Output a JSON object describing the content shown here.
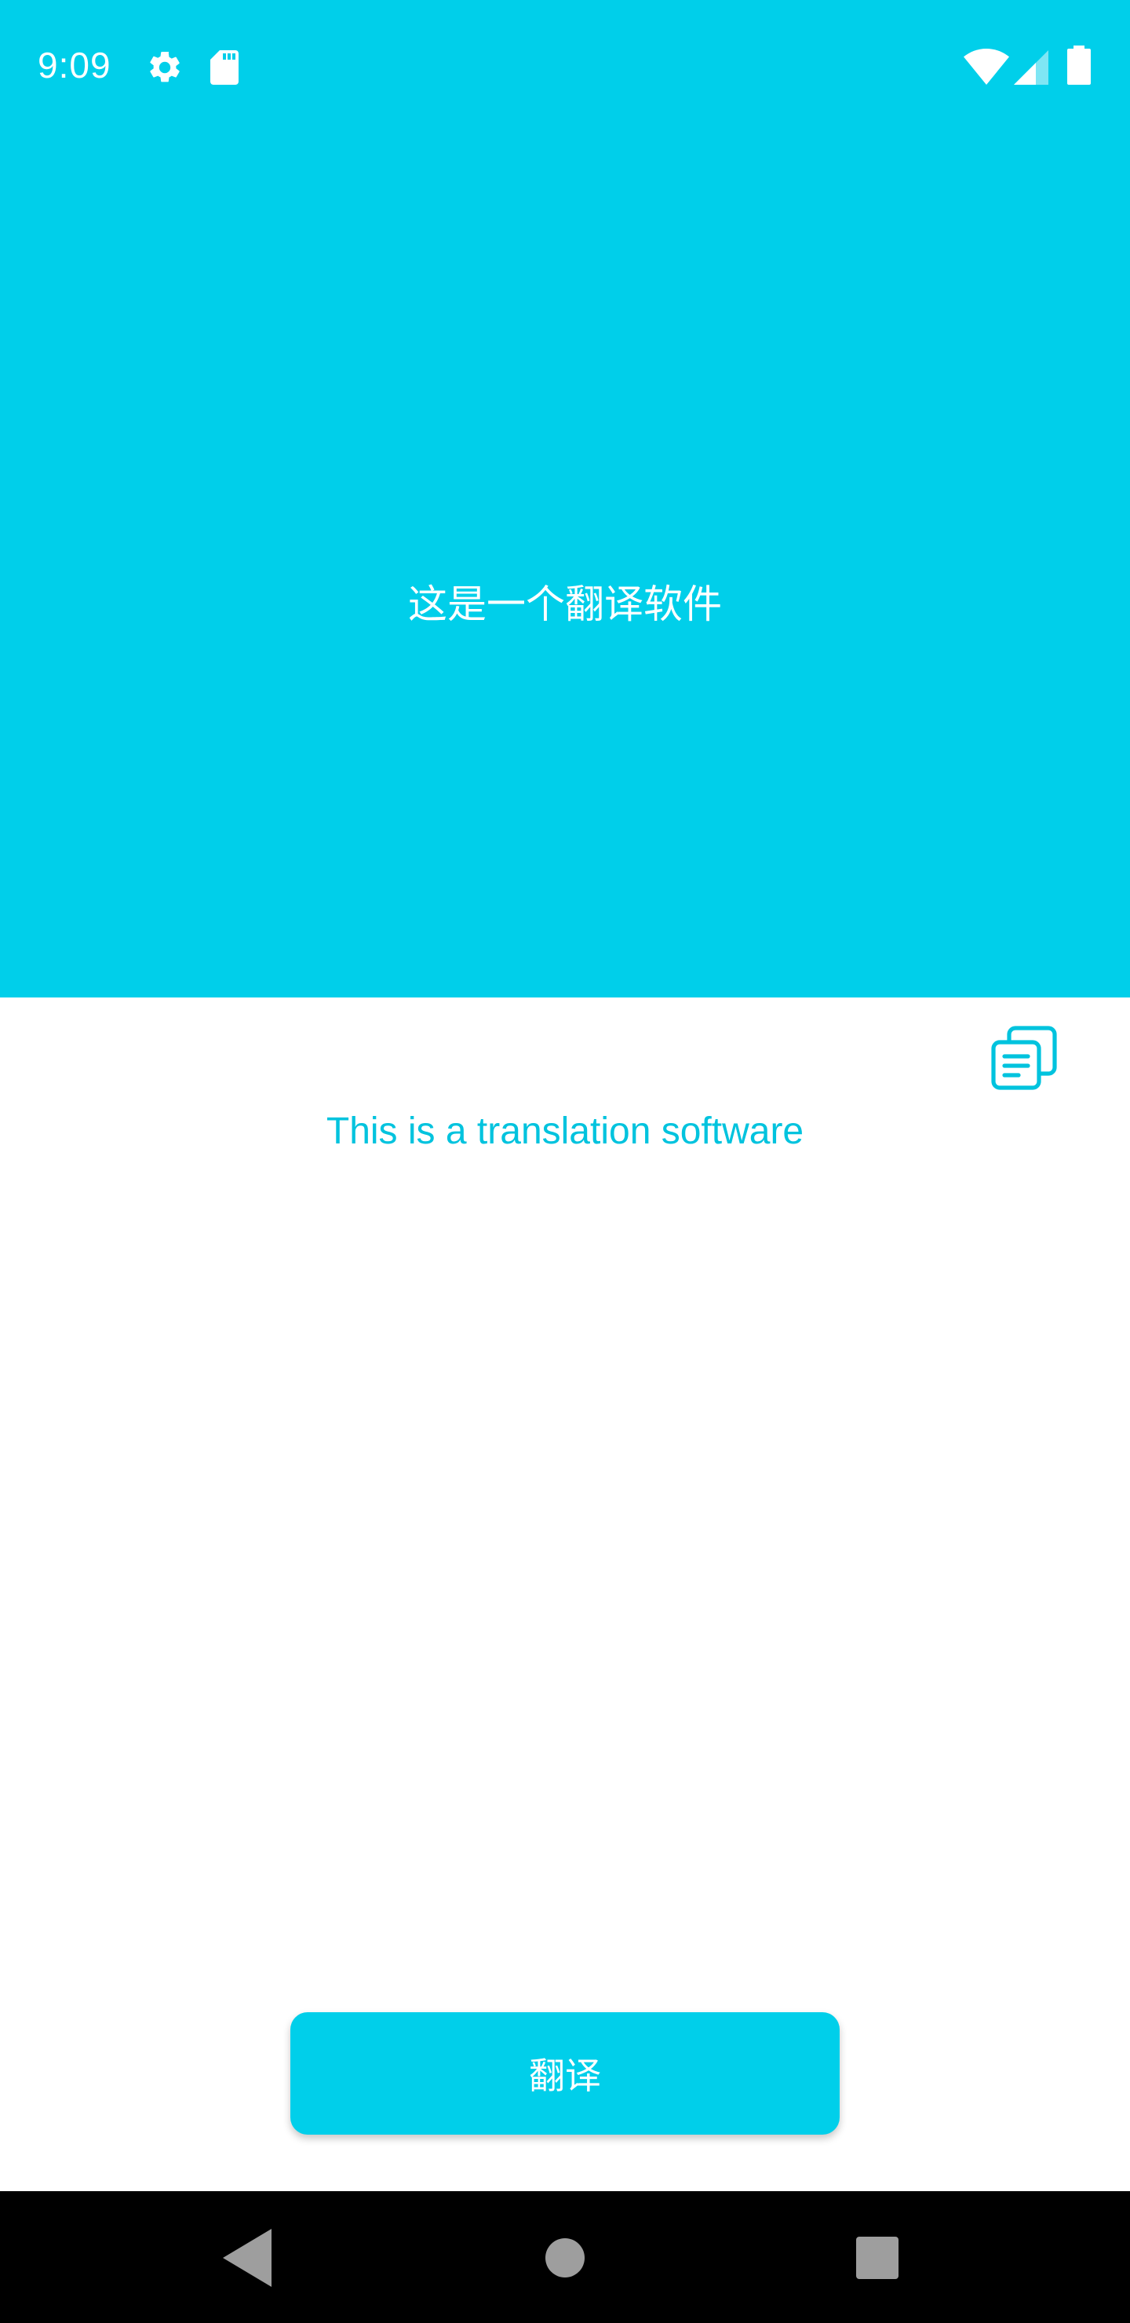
{
  "status_bar": {
    "time": "9:09",
    "icons": [
      "gear-icon",
      "sd-card-icon",
      "wifi-icon",
      "cell-signal-icon",
      "battery-icon"
    ]
  },
  "source": {
    "text": "这是一个翻译软件"
  },
  "result": {
    "text": "This is a translation software",
    "copy_icon": "copy-icon"
  },
  "actions": {
    "translate_label": "翻译"
  },
  "nav_bar": {
    "icons": [
      "back-icon",
      "home-icon",
      "recents-icon"
    ]
  },
  "colors": {
    "accent": "#00CFEA",
    "result_text": "#00C3DE",
    "nav_background": "#000000",
    "nav_icons": "#9E9E9E"
  }
}
